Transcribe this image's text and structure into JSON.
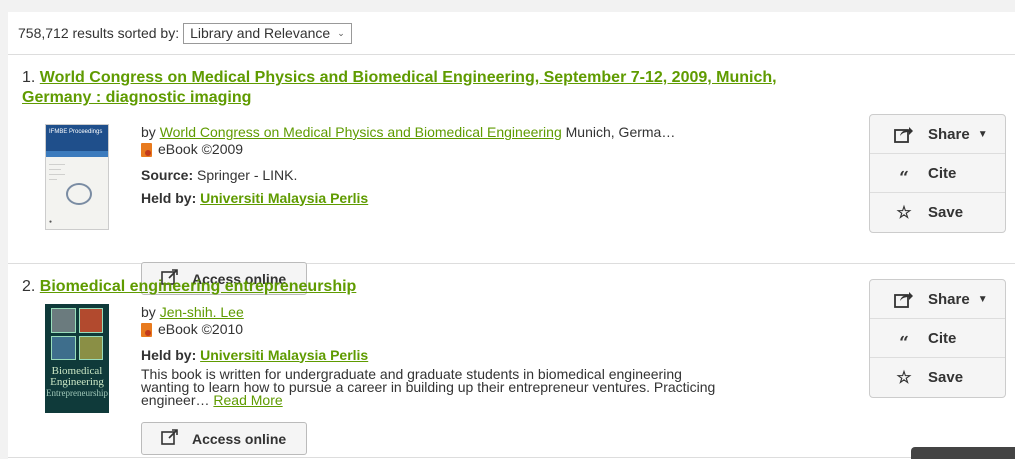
{
  "sort": {
    "count_text": "758,712 results sorted by:",
    "selected": "Library and Relevance"
  },
  "actions": {
    "share": "Share",
    "cite": "Cite",
    "save": "Save",
    "access": "Access online"
  },
  "results": [
    {
      "number": "1.",
      "title": "World Congress on Medical Physics and Biomedical Engineering, September 7-12, 2009, Munich, Germany : diagnostic imaging",
      "by_prefix": "by",
      "author": "World Congress on Medical Physics and Biomedical Engineering",
      "author_suffix": "Munich, Germa…",
      "format": "eBook ©2009",
      "source_label": "Source:",
      "source": "Springer - LINK.",
      "held_label": "Held by:",
      "held_by": "Universiti Malaysia Perlis",
      "cover_text": "IFMBE Proceedings"
    },
    {
      "number": "2.",
      "title": "Biomedical engineering entrepreneurship",
      "by_prefix": "by",
      "author": "Jen-shih. Lee",
      "format": "eBook ©2010",
      "held_label": "Held by:",
      "held_by": "Universiti Malaysia Perlis",
      "description": "This book is written for undergraduate and graduate students in biomedical engineering wanting to learn how to pursue a career in building up their entrepreneur ventures. Practicing engineer…",
      "read_more": "Read More",
      "cover_title_1": "Biomedical",
      "cover_title_2": "Engineering",
      "cover_subtitle": "Entrepreneurship"
    }
  ]
}
